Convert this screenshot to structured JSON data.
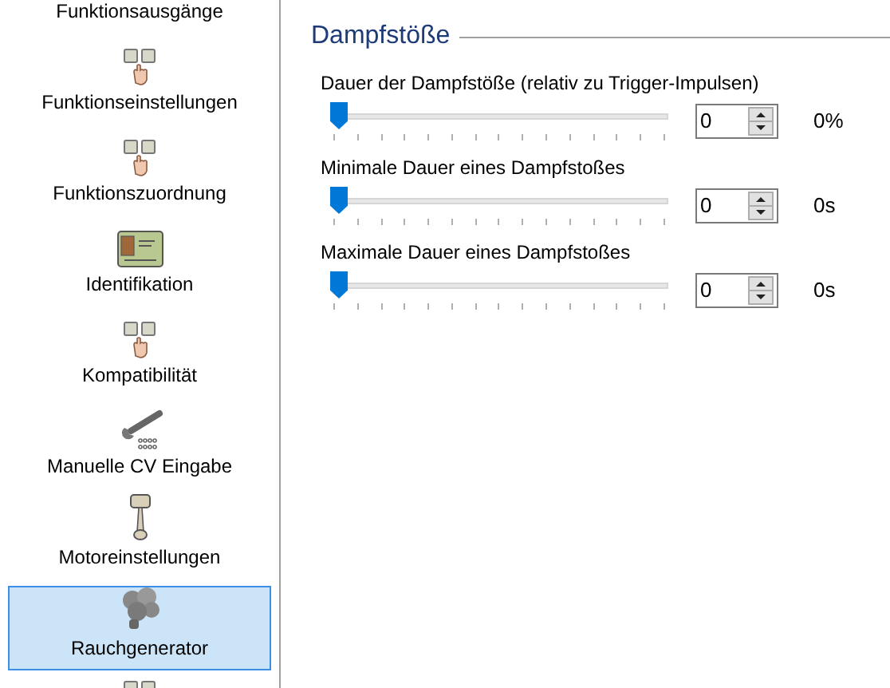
{
  "sidebar": {
    "items": [
      {
        "label": "Funktionsausgänge",
        "kind": "none",
        "selected": false
      },
      {
        "label": "Funktionseinstellungen",
        "kind": "fkeys",
        "selected": false
      },
      {
        "label": "Funktionszuordnung",
        "kind": "fkeys",
        "selected": false
      },
      {
        "label": "Identifikation",
        "kind": "card",
        "selected": false
      },
      {
        "label": "Kompatibilität",
        "kind": "fkeys",
        "selected": false
      },
      {
        "label": "Manuelle CV Eingabe",
        "kind": "wrench",
        "selected": false
      },
      {
        "label": "Motoreinstellungen",
        "kind": "piston",
        "selected": false
      },
      {
        "label": "Rauchgenerator",
        "kind": "smoke",
        "selected": true
      },
      {
        "kind": "fkeys",
        "selected": false
      }
    ]
  },
  "group": {
    "title": "Dampfstöße",
    "settings": [
      {
        "label": "Dauer der Dampfstöße (relativ zu Trigger-Impulsen)",
        "level": 0,
        "value": "0",
        "reading": "0%"
      },
      {
        "label": "Minimale Dauer eines Dampfstoßes",
        "level": 0,
        "value": "0",
        "reading": "0s"
      },
      {
        "label": "Maximale Dauer eines Dampfstoßes",
        "level": 0,
        "value": "0",
        "reading": "0s"
      }
    ]
  }
}
